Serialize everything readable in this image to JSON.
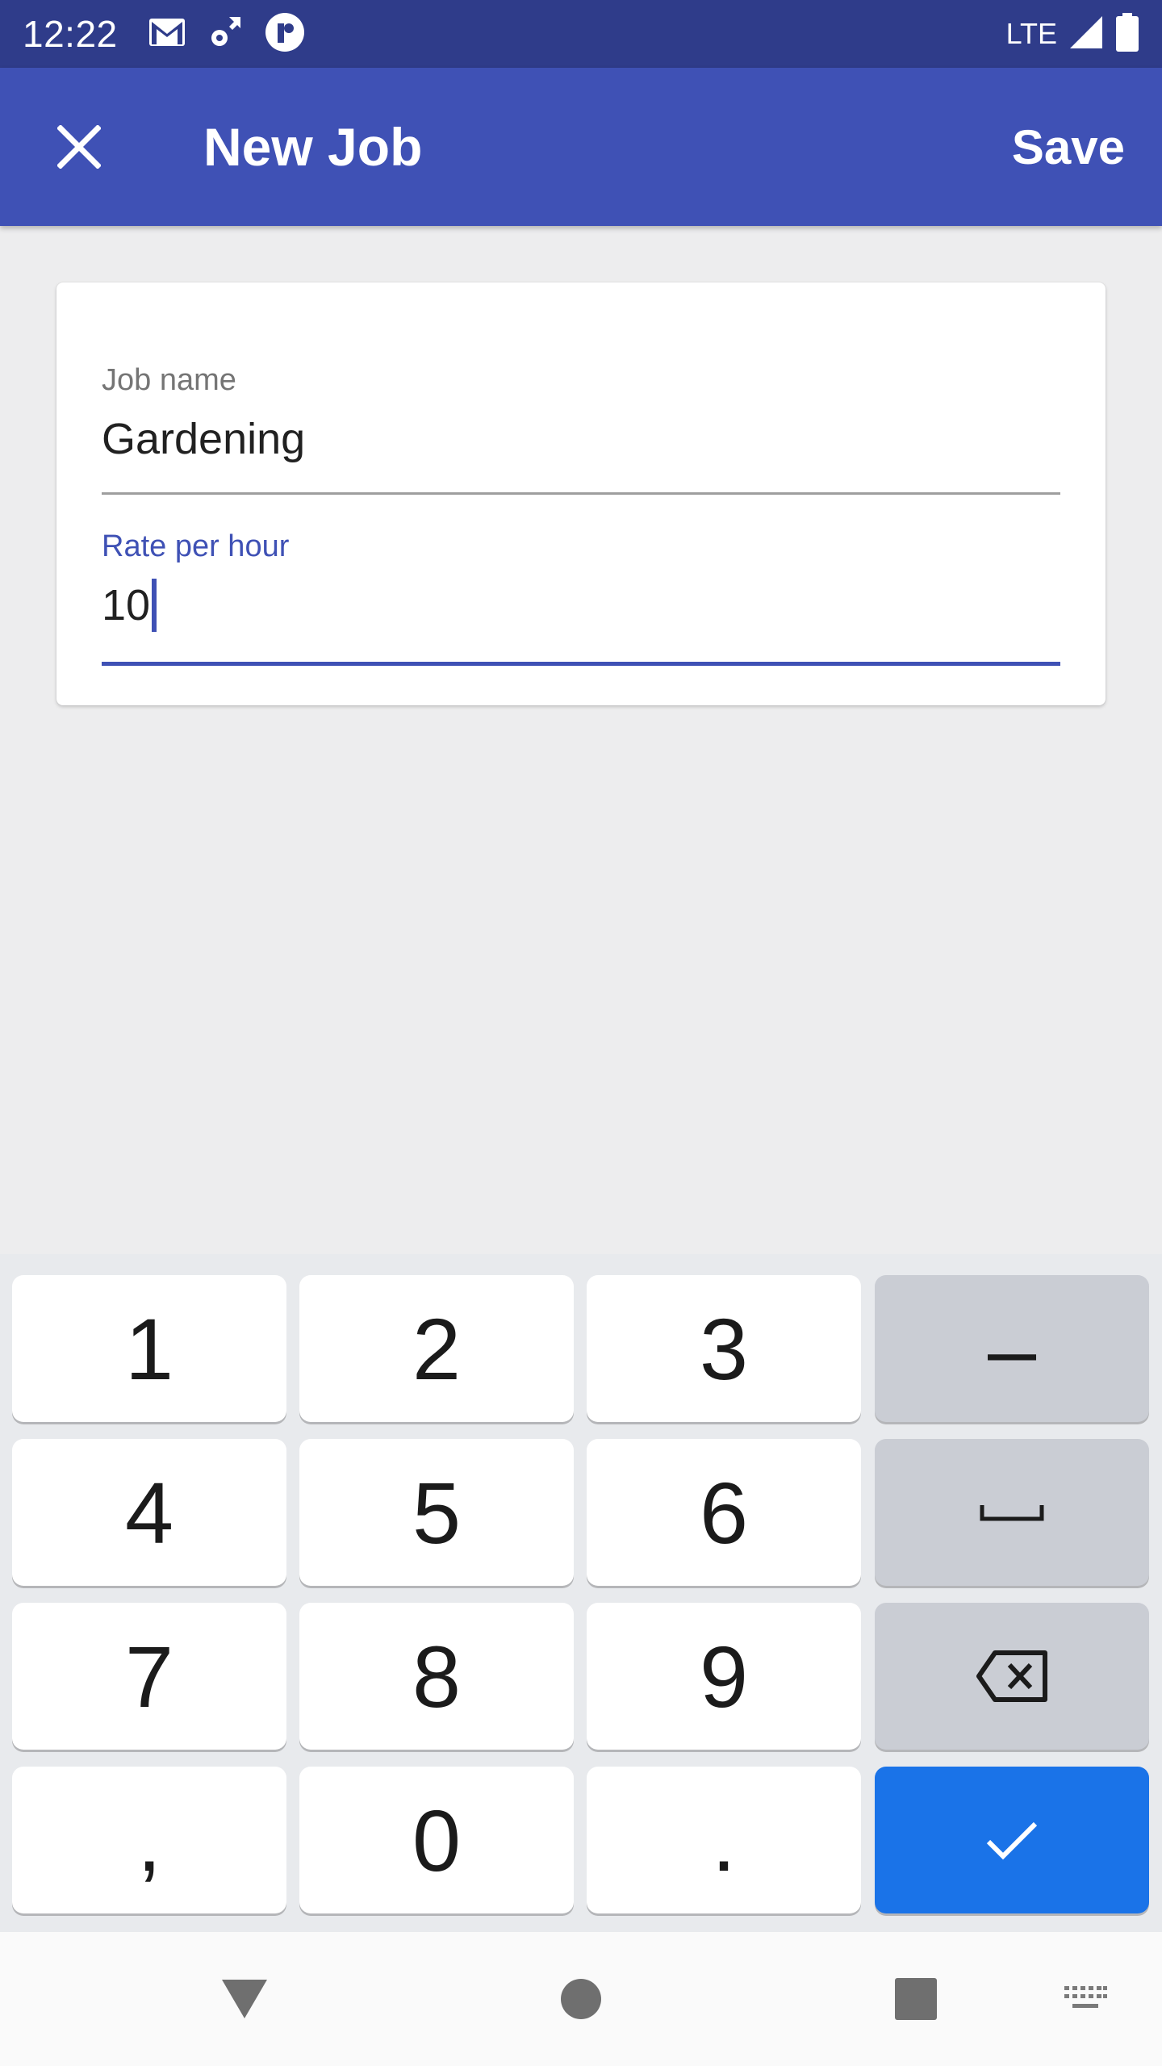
{
  "status_bar": {
    "time": "12:22",
    "network": "LTE",
    "icons": [
      "gmail-icon",
      "settings-sync-icon",
      "app-notification-icon",
      "signal-icon",
      "battery-icon"
    ]
  },
  "app_bar": {
    "title": "New Job",
    "save_label": "Save",
    "close_icon": "close-icon",
    "color": "#3f51b5"
  },
  "form": {
    "job_name": {
      "label": "Job name",
      "value": "Gardening"
    },
    "rate": {
      "label": "Rate per hour",
      "value": "10",
      "focused": true
    }
  },
  "keyboard": {
    "keys": {
      "k1": "1",
      "k2": "2",
      "k3": "3",
      "minus": "–",
      "k4": "4",
      "k5": "5",
      "k6": "6",
      "space_icon": "space-icon",
      "k7": "7",
      "k8": "8",
      "k9": "9",
      "backspace_icon": "backspace-icon",
      "comma": ",",
      "k0": "0",
      "period": ".",
      "enter_icon": "checkmark-icon"
    },
    "enter_color": "#1a73e8"
  },
  "nav_bar": {
    "icons": [
      "back-triangle-icon",
      "home-circle-icon",
      "recents-square-icon",
      "keyboard-icon"
    ]
  }
}
